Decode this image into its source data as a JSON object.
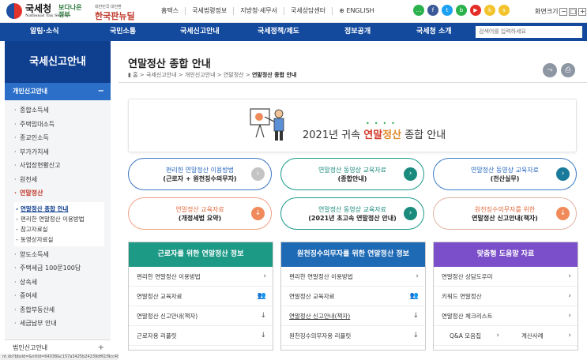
{
  "header": {
    "logo_name": "국세청",
    "logo_sub": "National Tax Service",
    "brand2_a": "보다나은",
    "brand2_b": "정부",
    "brand3_small": "대한민국 대전환",
    "brand3": "한국판뉴딜",
    "links": [
      "홈택스",
      "국세법령정보",
      "지방청·세무서",
      "국세상담센터",
      "⊕ ENGLISH"
    ],
    "zoom_label": "화면크기",
    "zoom_minus": "−",
    "zoom_reset": "□",
    "zoom_plus": "+"
  },
  "sns": [
    {
      "name": "talk",
      "color": "#2bb24c",
      "glyph": "…"
    },
    {
      "name": "facebook",
      "color": "#3b5998",
      "glyph": "f"
    },
    {
      "name": "twitter",
      "color": "#1da1f2",
      "glyph": "t"
    },
    {
      "name": "blog",
      "color": "#2ab14a",
      "glyph": "b"
    },
    {
      "name": "youtube",
      "color": "#e52d27",
      "glyph": "▶"
    },
    {
      "name": "kakao",
      "color": "#f3c32b",
      "glyph": "k"
    },
    {
      "name": "kakaostory",
      "color": "#f3c32b",
      "glyph": "s"
    }
  ],
  "gnb": {
    "items": [
      "알림·소식",
      "국민소통",
      "국세신고안내",
      "국세정책/제도",
      "정보공개",
      "국세청 소개"
    ],
    "search_placeholder": "검색어를 입력하세요"
  },
  "sidebar": {
    "title": "국세신고안내",
    "section": "개인신고안내",
    "section_toggle": "−",
    "items": [
      "종합소득세",
      "주택임대소득",
      "종교인소득",
      "부가가치세",
      "사업장현황신고",
      "원천세",
      "연말정산"
    ],
    "sub_items": [
      "연말정산 종합 안내",
      "편리한 연말정산 이용방법",
      "참고자료실",
      "동영상자료실"
    ],
    "items2": [
      "양도소득세",
      "주택세금 100문100답",
      "상속세",
      "증여세",
      "종합부동산세",
      "세금납부 안내"
    ],
    "footer": "법인신고안내",
    "footer_toggle": "+"
  },
  "page": {
    "title": "연말정산 종합 안내",
    "breadcrumb": [
      "홈",
      "국세신고안내",
      "개인신고안내",
      "연말정산",
      "연말정산 종합 안내"
    ],
    "breadcrumb_sep": ">",
    "tools": [
      "share",
      "print"
    ]
  },
  "banner": {
    "prefix": "2021년 귀속 ",
    "hl1": "연말",
    "hl2": "정산",
    "suffix": " 종합 안내",
    "dots": "••••"
  },
  "pills": [
    {
      "l1": "편리한 연말정산 이용방법",
      "l2": "(근로자 + 원천징수의무자)",
      "go": "›"
    },
    {
      "l1": "연말정산 동영상 교육자료",
      "l2": "(종합안내)",
      "go": "›"
    },
    {
      "l1": "연말정산 동영상 교육자료",
      "l2": "(전산실무)",
      "go": "›"
    },
    {
      "l1": "연말정산 교육자료",
      "l2": "(개정세법 요약)",
      "go": "↓"
    },
    {
      "l1": "연말정산 동영상 교육자료",
      "l2": "(2021년 초고속 연말정산 안내)",
      "go": "›"
    },
    {
      "l1": "원천징수의무자를 위한",
      "l2": "연말정산 신고안내(책자)",
      "go": "↓"
    }
  ],
  "cards": [
    {
      "title": "근로자를 위한 연말정산 정보",
      "color": "#1c9a86",
      "rows": [
        {
          "label": "편리한 연말정산 이용방법",
          "icon": "›"
        },
        {
          "label": "연말정산 교육자료",
          "icon": "👥"
        },
        {
          "label": "연말정산 신고안내(책자)",
          "icon": "↓"
        },
        {
          "label": "근로자용 리플릿",
          "icon": "↓"
        }
      ]
    },
    {
      "title": "원천징수의무자를 위한 연말정산 정보",
      "color": "#1f6ab5",
      "rows": [
        {
          "label": "편리한 연말정산 이용방법",
          "icon": "›"
        },
        {
          "label": "연말정산 교육자료",
          "icon": "👥"
        },
        {
          "label": "연말정산 신고안내(책자)",
          "icon": "↓"
        },
        {
          "label": "원천징수의무자용 리플릿",
          "icon": "↓"
        }
      ]
    },
    {
      "title": "맞춤형 도움말 자료",
      "color": "#7b4fc9",
      "rows": [
        {
          "label": "연말정산 상담도우미",
          "icon": "›"
        },
        {
          "label": "키워드 연말정산",
          "icon": "›"
        },
        {
          "label": "연말정산 체크리스트",
          "icon": "›"
        }
      ],
      "split": [
        {
          "label": "Q&A 모음집",
          "icon": "›"
        },
        {
          "label": "계산사례",
          "icon": "›"
        }
      ]
    }
  ],
  "statusbar": "nt.do?bbsId=&nttId=64038&c157a3425b24239df61f9cc48"
}
